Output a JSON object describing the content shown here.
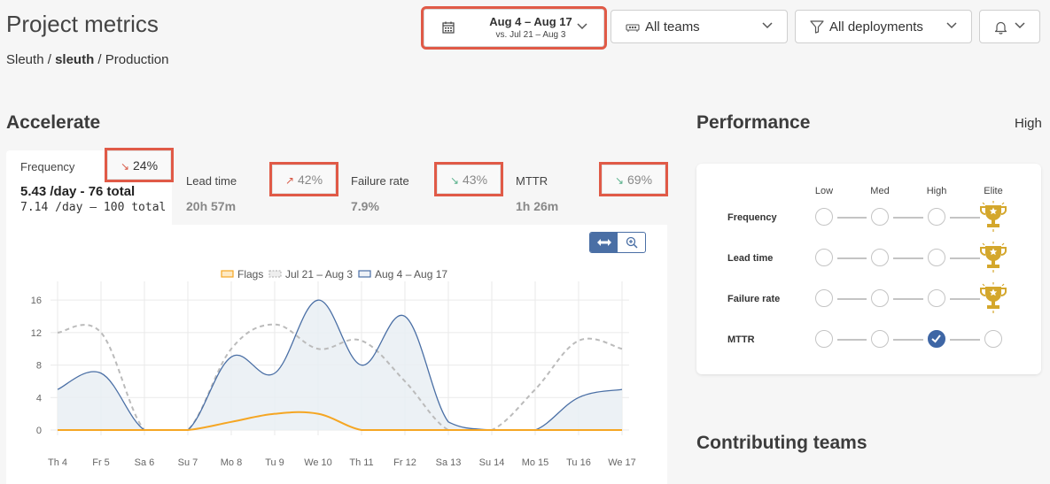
{
  "header": {
    "title": "Project metrics",
    "breadcrumb": {
      "org": "Sleuth",
      "project": "sleuth",
      "env": "Production",
      "sep": "/"
    },
    "date_range": {
      "main": "Aug 4 – Aug 17",
      "compare": "vs. Jul 21 – Aug 3"
    },
    "teams_filter": "All teams",
    "deployments_filter": "All deployments"
  },
  "accelerate": {
    "title": "Accelerate",
    "metrics": [
      {
        "label": "Frequency",
        "value": "5.43 /day - 76 total",
        "compare": "7.14 /day – 100 total",
        "change": "24%",
        "direction": "down",
        "color": "#d85a47"
      },
      {
        "label": "Lead time",
        "value": "20h 57m",
        "change": "42%",
        "direction": "up",
        "color": "#d85a47"
      },
      {
        "label": "Failure rate",
        "value": "7.9%",
        "change": "43%",
        "direction": "down",
        "color": "#5ab28d"
      },
      {
        "label": "MTTR",
        "value": "1h 26m",
        "change": "69%",
        "direction": "down",
        "color": "#5ab28d"
      }
    ]
  },
  "chart_data": {
    "type": "line",
    "categories": [
      "Th 4",
      "Fr 5",
      "Sa 6",
      "Su 7",
      "Mo 8",
      "Tu 9",
      "We 10",
      "Th 11",
      "Fr 12",
      "Sa 13",
      "Su 14",
      "Mo 15",
      "Tu 16",
      "We 17"
    ],
    "series": [
      {
        "name": "Flags",
        "values": [
          0,
          0,
          0,
          0,
          1,
          2,
          2,
          0,
          0,
          0,
          0,
          0,
          0,
          0
        ],
        "color": "#f5a623",
        "style": "solid"
      },
      {
        "name": "Jul 21 – Aug 3",
        "values": [
          12,
          12,
          0,
          0,
          10,
          13,
          10,
          11,
          6,
          0,
          0,
          5,
          11,
          10
        ],
        "color": "#bbbbbb",
        "style": "dashed"
      },
      {
        "name": "Aug 4 – Aug 17",
        "values": [
          5,
          7,
          0,
          0,
          9,
          7,
          16,
          8,
          14,
          1,
          0,
          0,
          4,
          5
        ],
        "color": "#4a6fa5",
        "style": "solid-filled"
      }
    ],
    "yticks": [
      0,
      4,
      8,
      12,
      16
    ],
    "ylim": [
      0,
      17
    ],
    "grid": true,
    "legend_position": "top"
  },
  "performance": {
    "title": "Performance",
    "overall": "High",
    "levels": [
      "Low",
      "Med",
      "High",
      "Elite"
    ],
    "rows": [
      {
        "label": "Frequency",
        "level": "Elite"
      },
      {
        "label": "Lead time",
        "level": "Elite"
      },
      {
        "label": "Failure rate",
        "level": "Elite"
      },
      {
        "label": "MTTR",
        "level": "High"
      }
    ],
    "trophy_color": "#d4a72c",
    "check_color": "#3e66a5"
  },
  "contributing": {
    "title": "Contributing teams"
  }
}
